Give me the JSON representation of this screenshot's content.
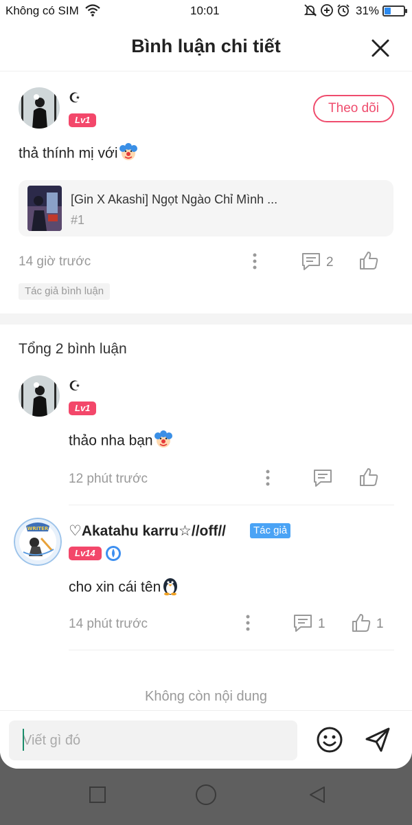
{
  "status_bar": {
    "carrier": "Không có SIM",
    "time": "10:01",
    "battery_percent_text": "31%",
    "battery_level": 0.31,
    "icons": [
      "wifi-icon",
      "mute-bell-icon",
      "data-saver-icon",
      "alarm-icon",
      "battery-icon"
    ]
  },
  "header": {
    "title": "Bình luận chi tiết",
    "close_icon": "close-icon"
  },
  "main_comment": {
    "username": "☪",
    "level": "Lv1",
    "follow_label": "Theo dõi",
    "text": "thả thính mị với",
    "emoji": "clown-face",
    "story": {
      "title": "[Gin X Akashi] Ngọt Ngào Chỉ Mình ...",
      "chapter": "#1"
    },
    "time": "14 giờ trước",
    "reply_count": "2",
    "author_tag": "Tác giả bình luận"
  },
  "replies_section": {
    "total_label": "Tổng 2 bình luận",
    "replies": [
      {
        "username": "☪",
        "level": "Lv1",
        "text": "thảo nha bạn",
        "emoji": "clown-face",
        "time": "12 phút trước"
      },
      {
        "username": "♡Akatahu karru☆//off//",
        "author_badge": "Tác giả",
        "level": "Lv14",
        "text": "cho xin cái tên",
        "emoji": "penguin",
        "time": "14 phút trước",
        "reply_count": "1",
        "like_count": "1"
      }
    ],
    "end_text": "Không còn nội dung"
  },
  "input_bar": {
    "placeholder": "Viết gì đó"
  },
  "colors": {
    "accent": "#ef4c6d",
    "level_badge": "#f3476a",
    "author_badge": "#4aa3f5",
    "muted_text": "#999999"
  }
}
